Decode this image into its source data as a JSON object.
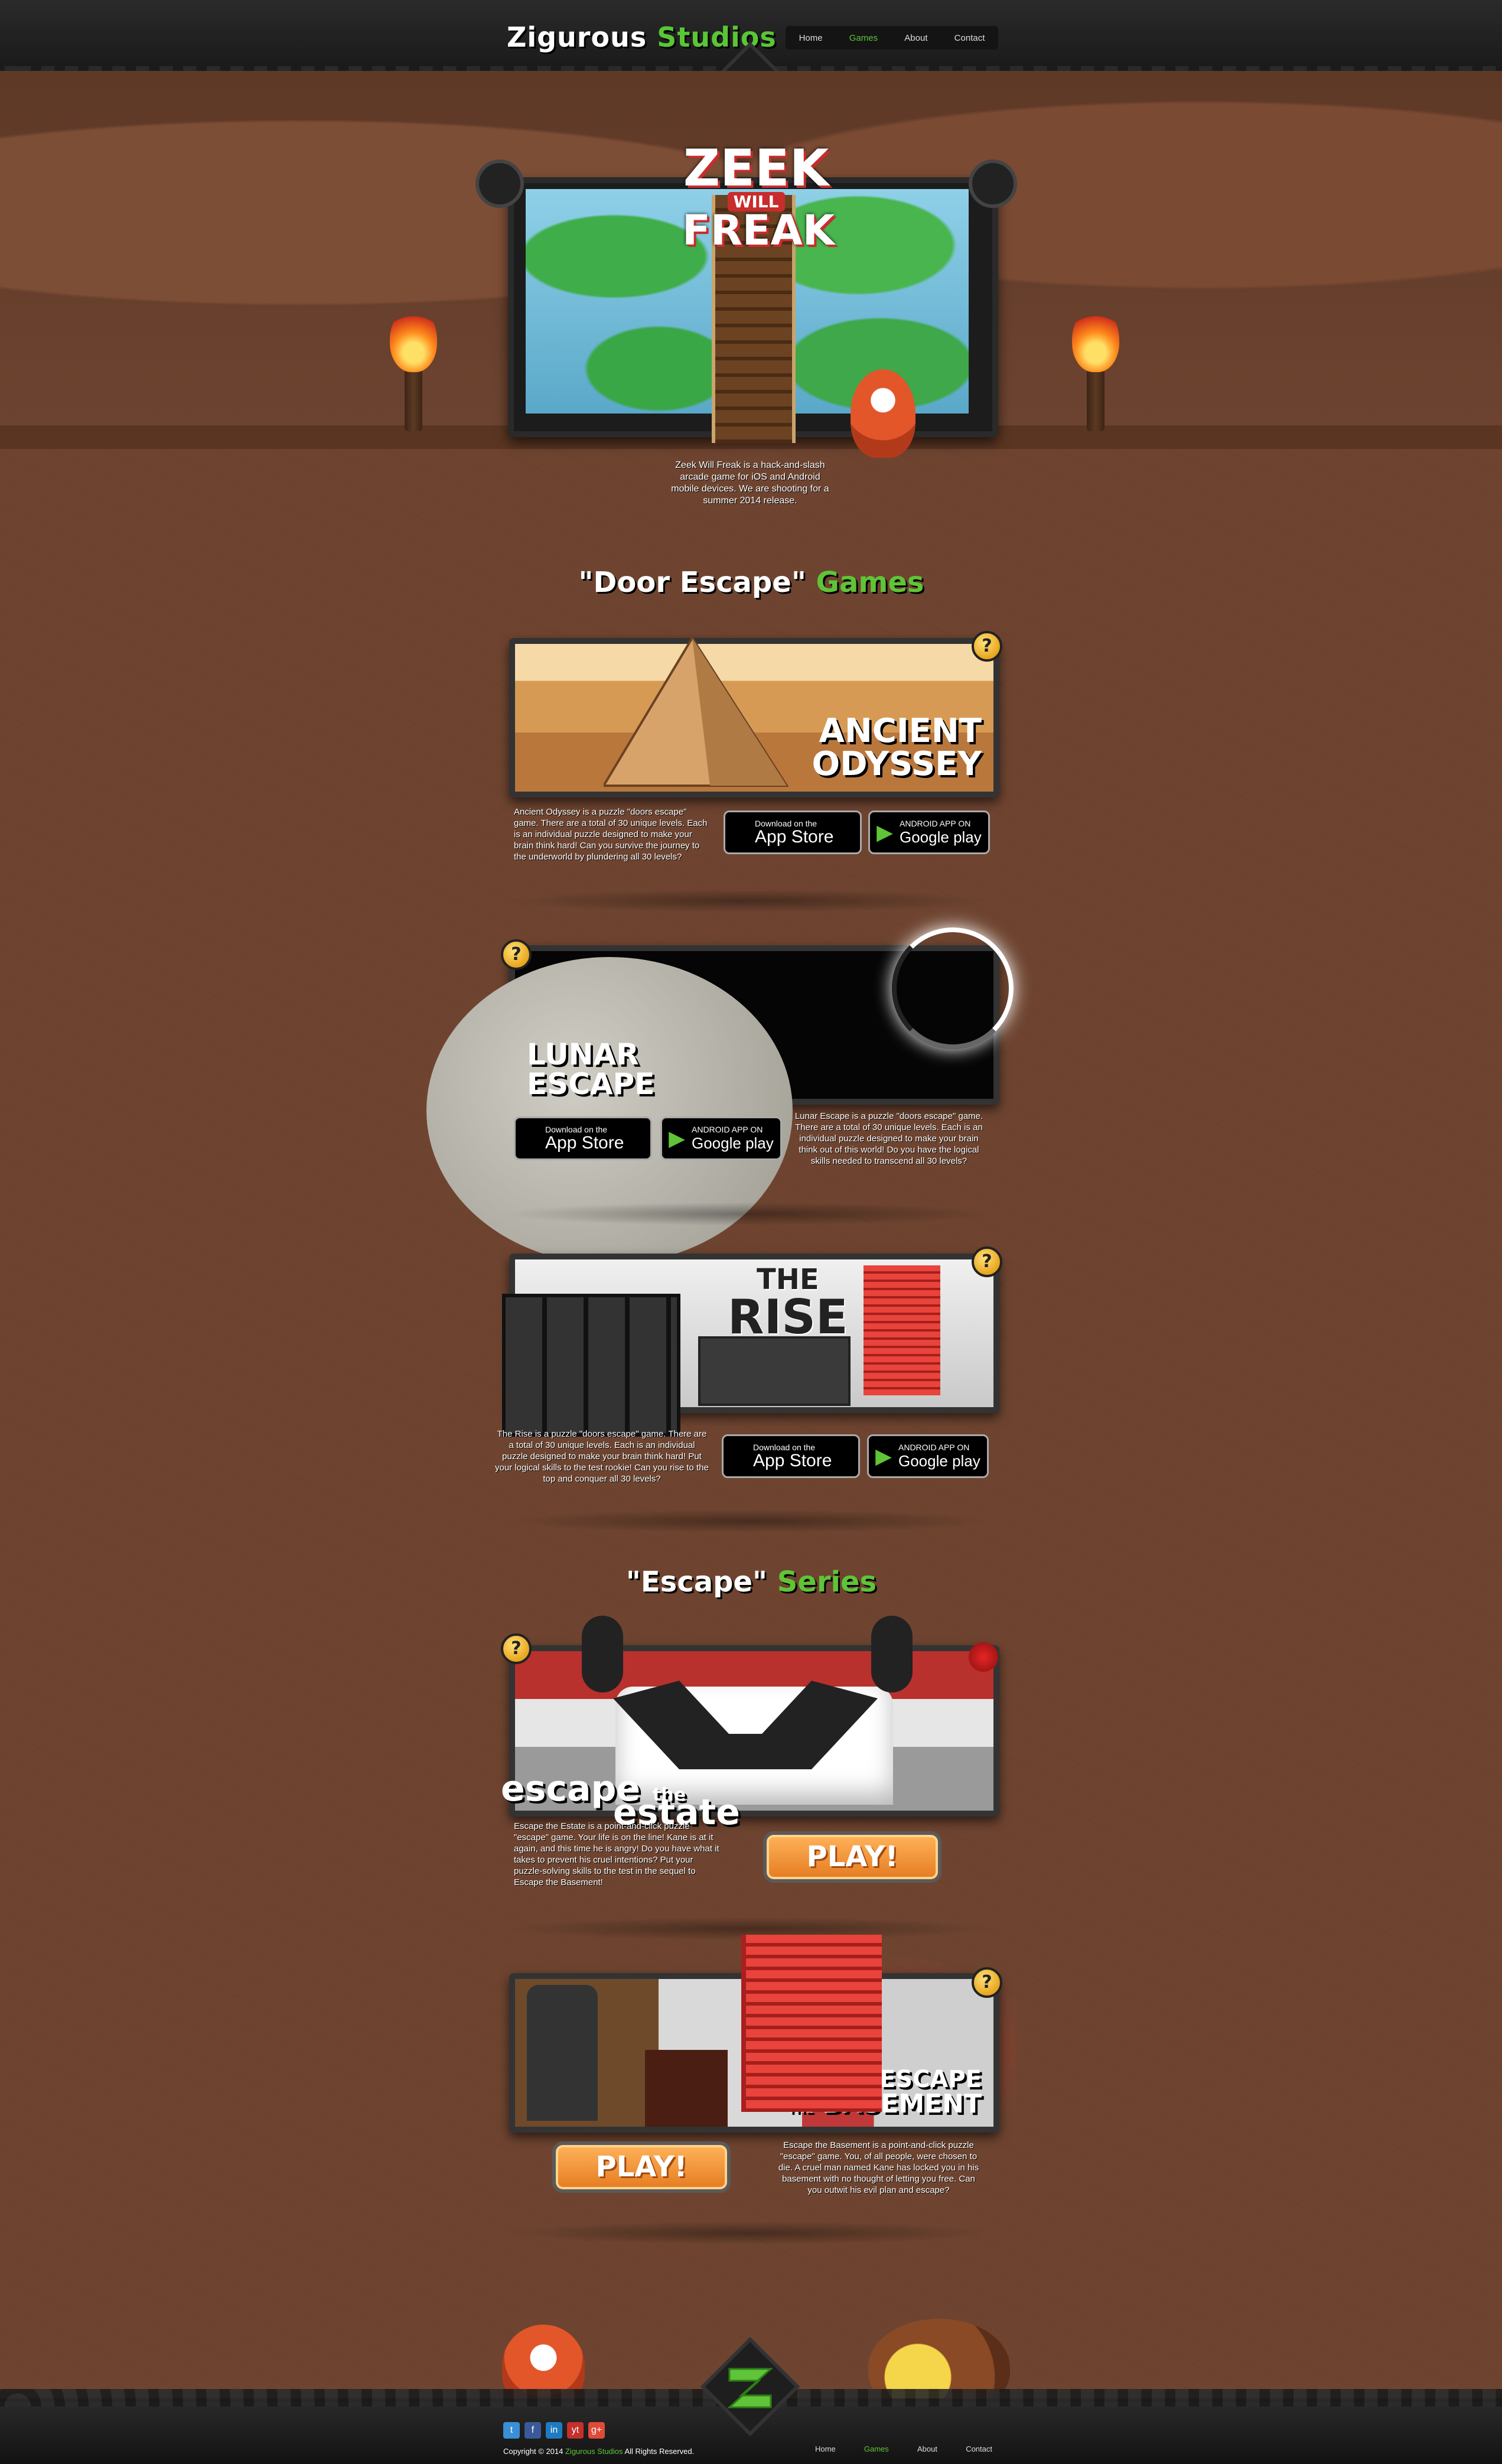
{
  "header": {
    "logo_word1": "Zigurous",
    "logo_word2": "Studios",
    "nav": [
      "Home",
      "Games",
      "About",
      "Contact"
    ]
  },
  "hero": {
    "title_line1": "ZEEK",
    "title_line2": "WILL",
    "title_line3": "FREAK",
    "description": "Zeek Will Freak is a hack-and-slash arcade game for iOS and Android mobile devices. We are shooting for a summer 2014 release."
  },
  "sections": {
    "door_escape": {
      "part1": "\"Door Escape\"",
      "part2": "Games"
    },
    "escape_series": {
      "part1": "\"Escape\"",
      "part2": "Series"
    }
  },
  "stores": {
    "app_top": "Download on the",
    "app_bottom": "App Store",
    "play_top": "ANDROID APP ON",
    "play_bottom": "Google play"
  },
  "games": {
    "ancient": {
      "title1": "ANCIENT",
      "title2": "ODYSSEY",
      "description": "Ancient Odyssey is a puzzle \"doors escape\" game. There are a total of 30 unique levels. Each is an individual puzzle designed to make your brain think hard! Can you survive the journey to the underworld by plundering all 30 levels?"
    },
    "lunar": {
      "title1": "LUNAR",
      "title2": "ESCAPE",
      "description": "Lunar Escape is a puzzle \"doors escape\" game. There are a total of 30 unique levels. Each is an individual puzzle designed to make your brain think out of this world! Do you have the logical skills needed to transcend all 30 levels?"
    },
    "rise": {
      "title1": "THE",
      "title2": "RISE",
      "description": "The Rise is a puzzle \"doors escape\" game. There are a total of 30 unique levels. Each is an individual puzzle designed to make your brain think hard! Put your logical skills to the test rookie! Can you rise to the top and conquer all 30 levels?"
    },
    "estate": {
      "title1": "escape",
      "title2": "the",
      "title3": "estate",
      "description": "Escape the Estate is a point-and-click puzzle \"escape\" game. Your life is on the line! Kane is at it again, and this time he is angry! Do you have what it takes to prevent his cruel intentions? Put your puzzle-solving skills to the test in the sequel to Escape the Basement!",
      "play": "PLAY!"
    },
    "basement": {
      "title1": "ESCAPE",
      "title2": "THE",
      "title3": "BASEMENT",
      "description": "Escape the Basement is a point-and-click puzzle \"escape\" game. You, of all people, were chosen to die. A cruel man named Kane has locked you in his basement with no thought of letting you free. Can you outwit his evil plan and escape?",
      "play": "PLAY!"
    }
  },
  "footer": {
    "social": [
      "t",
      "f",
      "in",
      "yt",
      "g+"
    ],
    "copyright_pre": "Copyright © 2014",
    "copyright_name": "Zigurous Studios",
    "copyright_post": "All Rights Reserved.",
    "nav": [
      "Home",
      "Games",
      "About",
      "Contact"
    ]
  },
  "colors": {
    "accent_green": "#5fc437",
    "background_brown": "#6e4430",
    "header_dark": "#1a1a1a"
  }
}
